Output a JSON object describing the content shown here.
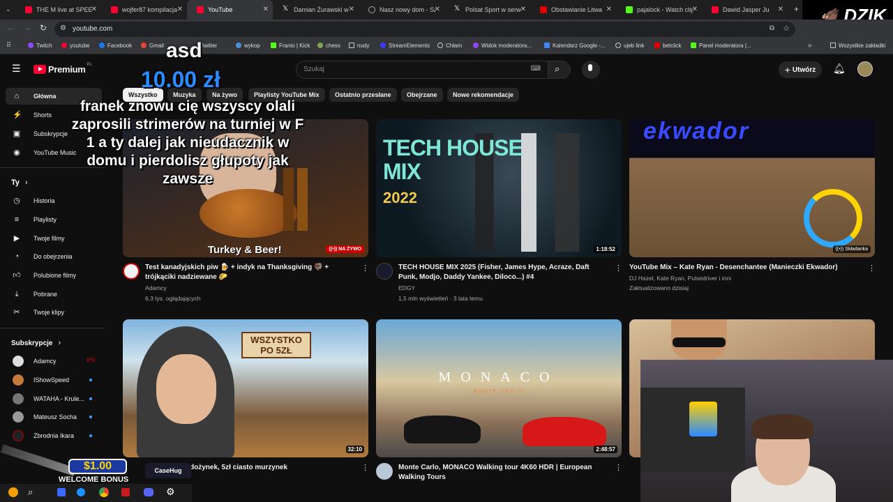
{
  "browser": {
    "tabs": [
      {
        "label": "THE M live at SPEEDL",
        "color": "#ff0033"
      },
      {
        "label": "wojfer87 kompilacja",
        "color": "#ff0033"
      },
      {
        "label": "YouTube",
        "color": "#ff0033"
      },
      {
        "label": "Damian Żurawski w",
        "color": "#ffffff"
      },
      {
        "label": "Nasz nowy dom - Sz",
        "color": "#aaaaaa"
      },
      {
        "label": "Polsat Sport w serwi",
        "color": "#ffffff"
      },
      {
        "label": "Obstawianie Litwa",
        "color": "#ff0033"
      },
      {
        "label": "pajalock - Watch clip",
        "color": "#53fc18"
      },
      {
        "label": "Dawid Jasper Ju",
        "color": "#ff0033"
      }
    ],
    "url": "youtube.com",
    "bookmarks": [
      "Twitch",
      "youtube",
      "Facebook",
      "Gmail",
      "twitter",
      "wykop",
      "Franio | Kick",
      "chess",
      "nudy",
      "StreamElements",
      "Chłam",
      "Widok moderatora...",
      "Kalendarz Google -...",
      "ujeb link",
      "betclick",
      "Panel moderatora |..."
    ],
    "all_bookmarks": "Wszystkie zakładki"
  },
  "youtube": {
    "logo": "Premium",
    "logo_region": "PL",
    "search_placeholder": "Szukaj",
    "create_label": "Utwórz",
    "chips": [
      "Wszystko",
      "Muzyka",
      "Na żywo",
      "Playlisty YouTube Mix",
      "Ostatnio przesłane",
      "Obejrzane",
      "Nowe rekomendacje"
    ],
    "sidebar": {
      "main": [
        "Główna",
        "Shorts",
        "Subskrypcje",
        "YouTube Music"
      ],
      "you_header": "Ty",
      "you": [
        "Historia",
        "Playlisty",
        "Twoje filmy",
        "Do obejrzenia",
        "Polubione filmy",
        "Pobrane",
        "Twoje klipy"
      ],
      "subs_header": "Subskrypcje",
      "subs": [
        "Adamcy",
        "IShowSpeed",
        "WATAHA - Krule...",
        "Mateusz Socha",
        "Zbrodnia Ikara"
      ]
    },
    "videos": [
      {
        "title": "Test kanadyjskich piw 🍺 + indyk na Thanksgiving 🦃 + trójkąciki nadziewane 🌮",
        "channel": "Adamcy",
        "meta": "6,3 tys. oglądających",
        "badge": "NA ŻYWO",
        "thumb_text": "Turkey & Beer!"
      },
      {
        "title": "TECH HOUSE MIX 2025 (Fisher, James Hype, Acraze, Daft Punk, Modjo, Daddy Yankee, Diloco...) #4",
        "channel": "EDGY",
        "meta": "1,5 mln wyświetleń · 3 lata temu",
        "duration": "1:18:52",
        "thumb_text": "TECH HOUSE MIX",
        "thumb_year": "2022"
      },
      {
        "title": "YouTube Mix – Kate Ryan - Desenchantee (Manieczki Ekwador)",
        "channel": "DJ Hazel, Kate Ryan, Pulsedriver i inni",
        "meta": "Zaktualizowano dzisiaj",
        "badge": "Składanka",
        "thumb_text": "Ekwador"
      },
      {
        "title": "dożynek, 5zł ciasto murzynek",
        "channel": "",
        "meta": "",
        "duration": "32:10",
        "thumb_text": "WSZYSTKO PO 5ZŁ"
      },
      {
        "title": "Monte Carlo, MONACO Walking tour 4K60 HDR | European Walking Tours",
        "channel": "",
        "meta": "",
        "duration": "2:48:57",
        "thumb_text": "MONACO",
        "thumb_sub": "MONTE CARLO"
      },
      {
        "title": "",
        "channel": "",
        "meta": "",
        "duration": ""
      }
    ]
  },
  "overlay": {
    "donor": "asd",
    "amount": "10.00 zł",
    "message": "franek znowu cię wszyscy olali zaprosili strimerów na turniej w F 1 a ty dalej jak nieudacznik w domu i pierdolisz głupoty jak zawsze",
    "brand": "DZIK",
    "promo_amount": "$1.00",
    "promo_label": "WELCOME BONUS",
    "promo_brand": "CaseHug"
  }
}
